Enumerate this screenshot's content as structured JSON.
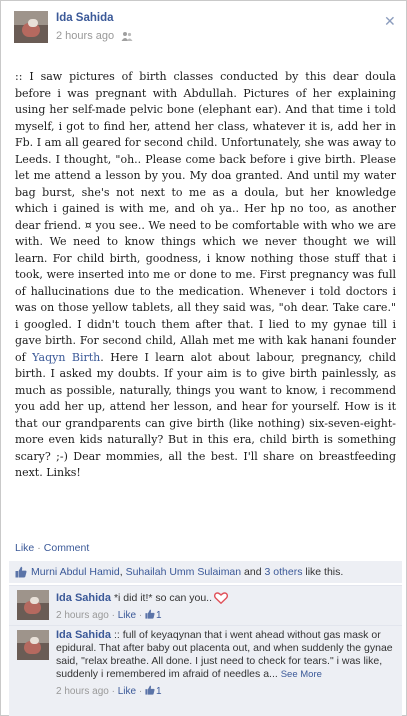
{
  "post": {
    "author": "Ida Sahida",
    "time": "2 hours ago",
    "close_glyph": "✕",
    "body_before_link": ":: I saw pictures of birth classes conducted by this dear doula before i was pregnant with Abdullah. Pictures of her explaining using her self-made pelvic bone (elephant ear). And that time i told myself, i got to find her, attend her class, whatever it is, add her in Fb. I am all geared for second child. Unfortunately, she was away to Leeds. I thought, \"oh.. Please come back before i give birth. Please let me attend a lesson by you. My doa granted. And until my water bag burst, she's not next to me as a doula, but her knowledge which i gained is with me, and oh ya.. Her hp no too, as another dear friend. ¤ you see.. We need to be comfortable with who we are with. We need to know things which we never thought we will learn. For child birth, goodness, i know nothing those stuff that i took, were inserted into me or done to me. First pregnancy was full of hallucinations due to the medication. Whenever i told doctors i was on those yellow tablets, all they said was, \"oh dear. Take care.\" i googled. I didn't touch them after that. I lied to my gynae till i gave birth. For second child, Allah met me with kak hanani founder of ",
    "body_link": "Yaqyn Birth",
    "body_after_link": ". Here I learn alot about labour, pregnancy, child birth. I asked my doubts. If your aim is to give birth painlessly, as much as possible, naturally, things you want to know, i recommend you add her up, attend her lesson, and hear for yourself. How is it that our grandparents can give birth (like nothing) six-seven-eight-more even kids naturally? But in this era, child birth is something scary? ;-) Dear mommies, all the best. I'll share on breastfeeding next. Links!"
  },
  "actions": {
    "like": "Like",
    "separator": "·",
    "comment": "Comment"
  },
  "likes": {
    "name1": "Murni Abdul Hamid",
    "comma": ",",
    "name2": "Suhailah Umm Sulaiman",
    "and": "and",
    "others": "3 others",
    "suffix": "like this."
  },
  "comments": [
    {
      "author": "Ida Sahida",
      "text": "*i did it!* so can you..",
      "time": "2 hours ago",
      "like": "Like",
      "like_count": "1"
    },
    {
      "author": "Ida Sahida",
      "text": ":: full of keyaqynan that i went ahead without gas mask or epidural. That after baby out placenta out, and when suddenly the gynae said, \"relax breathe. All done. I just need to check for tears.\" i was like, suddenly i remembered im afraid of needles a...",
      "see_more": "See More",
      "time": "2 hours ago",
      "like": "Like",
      "like_count": "1"
    }
  ],
  "colors": {
    "link": "#3b5998",
    "like_bar": "#edeff4",
    "heart": "#e0525b"
  },
  "icons": [
    "people-icon",
    "close-icon",
    "thumbs-up-icon",
    "heart-icon"
  ]
}
